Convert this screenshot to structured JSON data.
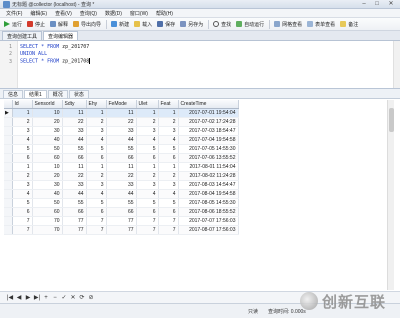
{
  "window": {
    "title": "无标题 @collector (localhost) - 查询 *",
    "minimize": "–",
    "maximize": "□",
    "close": "✕"
  },
  "menu": [
    "文件(F)",
    "编辑(E)",
    "查看(V)",
    "查询(Q)",
    "数据(D)",
    "窗口(W)",
    "帮助(H)"
  ],
  "toolbar": {
    "run": "运行",
    "stop": "停止",
    "explain": "解释",
    "export_wizard": "导出向导",
    "new": "新建",
    "load": "载入",
    "save": "保存",
    "save_as": "另存为",
    "find": "查找",
    "auto_run": "自动运行",
    "query_builder": "网格查看",
    "form_view": "表单查看",
    "note": "备注"
  },
  "query_tabs": [
    "查询创建工具",
    "查询编辑器"
  ],
  "editor": {
    "lines": [
      {
        "num": "1",
        "kw": "SELECT * FROM",
        "rest": " zp_201707"
      },
      {
        "num": "2",
        "kw": "UNION ALL",
        "rest": ""
      },
      {
        "num": "3",
        "kw": "SELECT * FROM",
        "rest": " zp_201708"
      }
    ]
  },
  "result_tabs": [
    "信息",
    "结果1",
    "概况",
    "状态"
  ],
  "grid": {
    "columns": [
      "Id",
      "SensorId",
      "Sdty",
      "Ehy",
      "FeMode",
      "Ulet",
      "Feat",
      "CreateTime"
    ],
    "rows": [
      [
        "1",
        "10",
        "11",
        "1",
        "11",
        "1",
        "1",
        "2017-07-01 19:54:04"
      ],
      [
        "2",
        "20",
        "22",
        "2",
        "22",
        "2",
        "2",
        "2017-07-02 17:24:28"
      ],
      [
        "3",
        "30",
        "33",
        "3",
        "33",
        "3",
        "3",
        "2017-07-03 18:54:47"
      ],
      [
        "4",
        "40",
        "44",
        "4",
        "44",
        "4",
        "4",
        "2017-07-04 19:54:58"
      ],
      [
        "5",
        "50",
        "55",
        "5",
        "55",
        "5",
        "5",
        "2017-07-05 14:55:30"
      ],
      [
        "6",
        "60",
        "66",
        "6",
        "66",
        "6",
        "6",
        "2017-07-06 13:55:52"
      ],
      [
        "1",
        "10",
        "11",
        "1",
        "11",
        "1",
        "1",
        "2017-08-01 11:54:04"
      ],
      [
        "2",
        "20",
        "22",
        "2",
        "22",
        "2",
        "2",
        "2017-08-02 11:24:28"
      ],
      [
        "3",
        "30",
        "33",
        "3",
        "33",
        "3",
        "3",
        "2017-08-03 14:54:47"
      ],
      [
        "4",
        "40",
        "44",
        "4",
        "44",
        "4",
        "4",
        "2017-08-04 19:54:58"
      ],
      [
        "5",
        "50",
        "55",
        "5",
        "55",
        "5",
        "5",
        "2017-08-05 14:55:30"
      ],
      [
        "6",
        "60",
        "66",
        "6",
        "66",
        "6",
        "6",
        "2017-08-06 18:55:52"
      ],
      [
        "7",
        "70",
        "77",
        "7",
        "77",
        "7",
        "7",
        "2017-07-07 17:56:03"
      ],
      [
        "7",
        "70",
        "77",
        "7",
        "77",
        "7",
        "7",
        "2017-08-07 17:56:03"
      ]
    ]
  },
  "nav": [
    "|◀",
    "◀",
    "▶",
    "▶|",
    "+",
    "−",
    "✓",
    "✕",
    "⟳",
    "⊘"
  ],
  "status": {
    "mode": "只读",
    "query_time": "查询时间: 0.000s"
  },
  "watermark": "创新互联",
  "colors": {
    "keyword": "#1f3fc8",
    "selected_row": "#ddeaf9",
    "run_icon": "#2e9e3a",
    "stop_icon": "#d33a2c"
  }
}
